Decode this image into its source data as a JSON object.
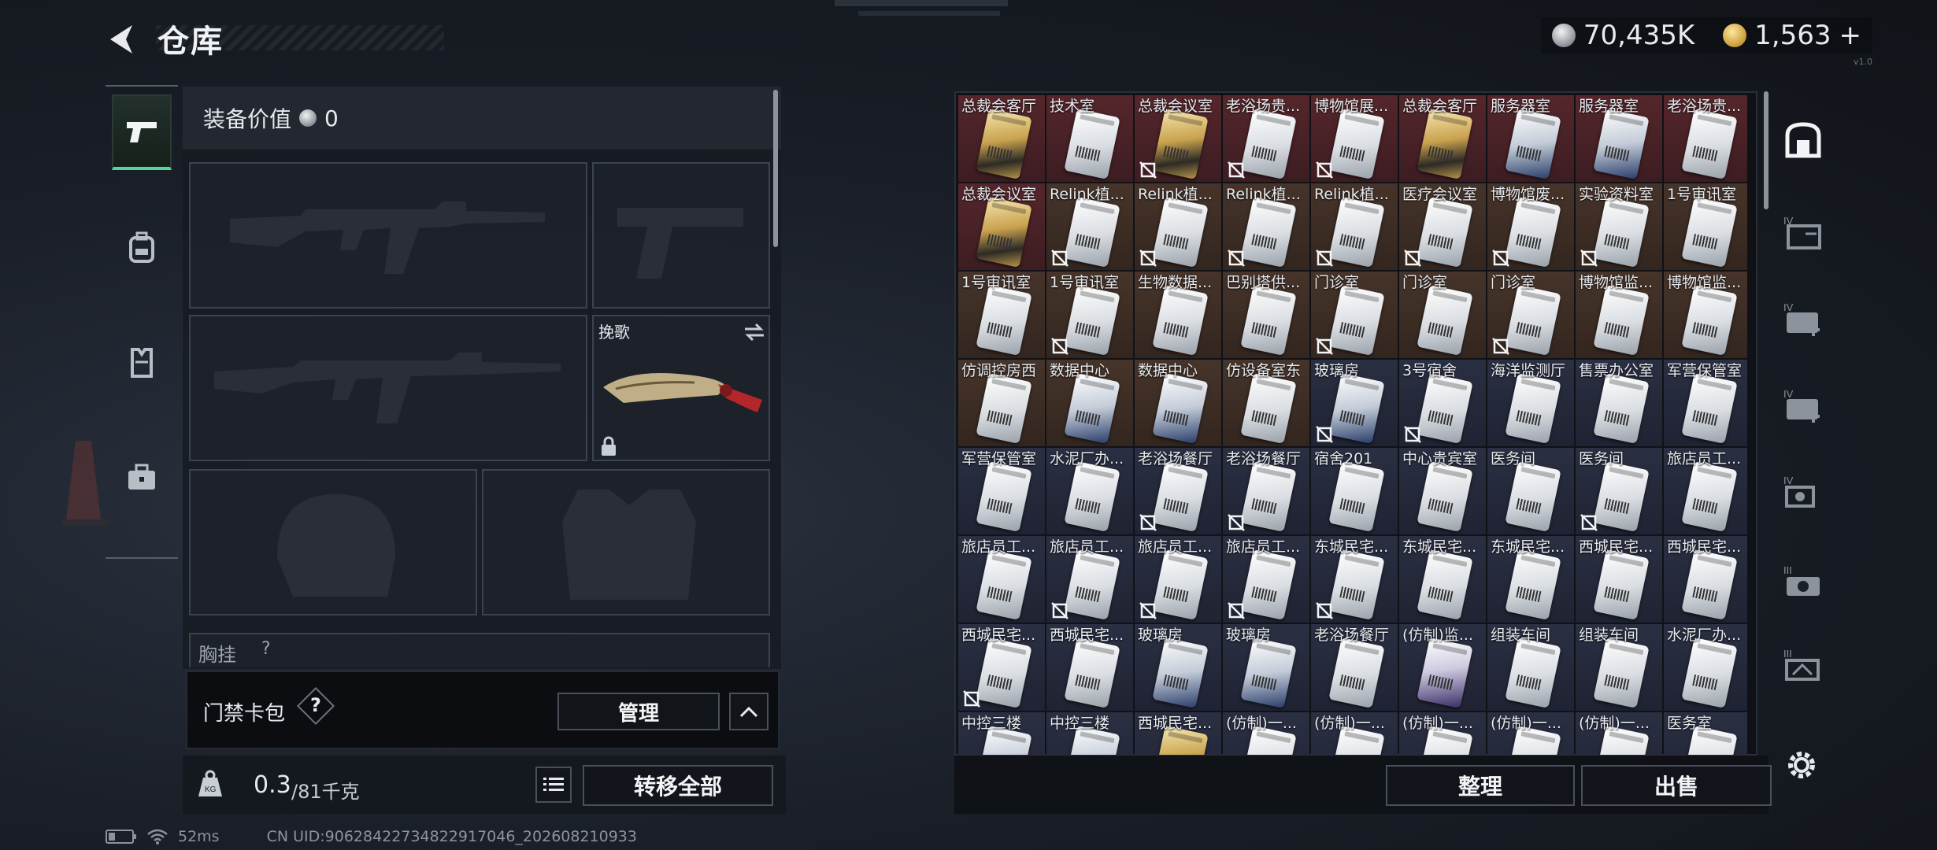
{
  "header": {
    "title": "仓库",
    "currency": [
      {
        "icon": "silver-coin-icon",
        "value": "70,435K"
      },
      {
        "icon": "gold-coin-icon",
        "value": "1,563"
      },
      {
        "icon": "plus-icon",
        "value": "+"
      }
    ],
    "version": "v1.0"
  },
  "left_tabs": [
    "pistol-icon",
    "backpack-icon",
    "vest-icon",
    "briefcase-icon"
  ],
  "equipment": {
    "value_label": "装备价值",
    "value": "0",
    "melee_name": "挽歌",
    "next_section": "胸挂",
    "next_section_help": "?"
  },
  "card_bag": {
    "label": "门禁卡包",
    "help": "?",
    "manage_label": "管理"
  },
  "weight": {
    "current": "0.3",
    "max": "/81千克"
  },
  "buttons": {
    "transfer_all": "转移全部",
    "organize": "整理",
    "sell": "出售"
  },
  "grid": {
    "cells": [
      {
        "name": "总裁会客厅",
        "bg": "r",
        "c": "gold",
        "nt": false
      },
      {
        "name": "技术室",
        "bg": "r",
        "c": "white",
        "nt": false
      },
      {
        "name": "总裁会议室",
        "bg": "r",
        "c": "gold",
        "nt": true
      },
      {
        "name": "老浴场贵...",
        "bg": "r",
        "c": "white",
        "nt": true
      },
      {
        "name": "博物馆展...",
        "bg": "r",
        "c": "white",
        "nt": true
      },
      {
        "name": "总裁会客厅",
        "bg": "r",
        "c": "gold",
        "nt": false
      },
      {
        "name": "服务器室",
        "bg": "r",
        "c": "blue",
        "nt": false
      },
      {
        "name": "服务器室",
        "bg": "r",
        "c": "blue",
        "nt": false
      },
      {
        "name": "老浴场贵...",
        "bg": "r",
        "c": "white",
        "nt": false
      },
      {
        "name": "总裁会议室",
        "bg": "r",
        "c": "gold",
        "nt": false
      },
      {
        "name": "Relink植...",
        "bg": "o",
        "c": "white",
        "nt": true
      },
      {
        "name": "Relink植...",
        "bg": "o",
        "c": "white",
        "nt": true
      },
      {
        "name": "Relink植...",
        "bg": "o",
        "c": "white",
        "nt": true
      },
      {
        "name": "Relink植...",
        "bg": "o",
        "c": "white",
        "nt": true
      },
      {
        "name": "医疗会议室",
        "bg": "o",
        "c": "white",
        "nt": true
      },
      {
        "name": "博物馆废...",
        "bg": "o",
        "c": "white",
        "nt": true
      },
      {
        "name": "实验资料室",
        "bg": "o",
        "c": "white",
        "nt": true
      },
      {
        "name": "1号审讯室",
        "bg": "o",
        "c": "white",
        "nt": false
      },
      {
        "name": "1号审讯室",
        "bg": "o",
        "c": "white",
        "nt": false
      },
      {
        "name": "1号审讯室",
        "bg": "o",
        "c": "white",
        "nt": true
      },
      {
        "name": "生物数据...",
        "bg": "o",
        "c": "white",
        "nt": false
      },
      {
        "name": "巴别塔供...",
        "bg": "o",
        "c": "white",
        "nt": false
      },
      {
        "name": "门诊室",
        "bg": "o",
        "c": "white",
        "nt": true
      },
      {
        "name": "门诊室",
        "bg": "o",
        "c": "white",
        "nt": false
      },
      {
        "name": "门诊室",
        "bg": "o",
        "c": "white",
        "nt": true
      },
      {
        "name": "博物馆监...",
        "bg": "o",
        "c": "white",
        "nt": false
      },
      {
        "name": "博物馆监...",
        "bg": "o",
        "c": "white",
        "nt": false
      },
      {
        "name": "仿调控房西",
        "bg": "o",
        "c": "white",
        "nt": false
      },
      {
        "name": "数据中心",
        "bg": "o",
        "c": "blue",
        "nt": false
      },
      {
        "name": "数据中心",
        "bg": "o",
        "c": "blue",
        "nt": false
      },
      {
        "name": "仿设备室东",
        "bg": "o",
        "c": "white",
        "nt": false
      },
      {
        "name": "玻璃房",
        "bg": "b",
        "c": "blue",
        "nt": true
      },
      {
        "name": "3号宿舍",
        "bg": "b",
        "c": "white",
        "nt": true
      },
      {
        "name": "海洋监测厅",
        "bg": "b",
        "c": "white",
        "nt": false
      },
      {
        "name": "售票办公室",
        "bg": "b",
        "c": "white",
        "nt": false
      },
      {
        "name": "军营保管室",
        "bg": "b",
        "c": "white",
        "nt": false
      },
      {
        "name": "军营保管室",
        "bg": "b",
        "c": "white",
        "nt": false
      },
      {
        "name": "水泥厂办...",
        "bg": "b",
        "c": "white",
        "nt": false
      },
      {
        "name": "老浴场餐厅",
        "bg": "b",
        "c": "white",
        "nt": true
      },
      {
        "name": "老浴场餐厅",
        "bg": "b",
        "c": "white",
        "nt": true
      },
      {
        "name": "宿舍201",
        "bg": "b",
        "c": "white",
        "nt": false
      },
      {
        "name": "中心贵宾室",
        "bg": "b",
        "c": "white",
        "nt": false
      },
      {
        "name": "医务间",
        "bg": "b",
        "c": "white",
        "nt": false
      },
      {
        "name": "医务间",
        "bg": "b",
        "c": "white",
        "nt": true
      },
      {
        "name": "旅店员工...",
        "bg": "b",
        "c": "white",
        "nt": false
      },
      {
        "name": "旅店员工...",
        "bg": "b",
        "c": "white",
        "nt": false
      },
      {
        "name": "旅店员工...",
        "bg": "b",
        "c": "white",
        "nt": true
      },
      {
        "name": "旅店员工...",
        "bg": "b",
        "c": "white",
        "nt": true
      },
      {
        "name": "旅店员工...",
        "bg": "b",
        "c": "white",
        "nt": true
      },
      {
        "name": "东城民宅...",
        "bg": "b",
        "c": "white",
        "nt": true
      },
      {
        "name": "东城民宅...",
        "bg": "b",
        "c": "white",
        "nt": false
      },
      {
        "name": "东城民宅...",
        "bg": "b",
        "c": "white",
        "nt": false
      },
      {
        "name": "西城民宅...",
        "bg": "b",
        "c": "white",
        "nt": false
      },
      {
        "name": "西城民宅...",
        "bg": "b",
        "c": "white",
        "nt": false
      },
      {
        "name": "西城民宅...",
        "bg": "b",
        "c": "white",
        "nt": true
      },
      {
        "name": "西城民宅...",
        "bg": "b",
        "c": "white",
        "nt": false
      },
      {
        "name": "玻璃房",
        "bg": "b",
        "c": "blue",
        "nt": false
      },
      {
        "name": "玻璃房",
        "bg": "b",
        "c": "blue",
        "nt": false
      },
      {
        "name": "老浴场餐厅",
        "bg": "b",
        "c": "white",
        "nt": false
      },
      {
        "name": "(仿制)监...",
        "bg": "b",
        "c": "purple",
        "nt": false
      },
      {
        "name": "组装车间",
        "bg": "b",
        "c": "white",
        "nt": false
      },
      {
        "name": "组装车间",
        "bg": "b",
        "c": "white",
        "nt": false
      },
      {
        "name": "水泥厂办...",
        "bg": "b",
        "c": "white",
        "nt": false
      },
      {
        "name": "中控三楼",
        "bg": "b",
        "c": "blue",
        "nt": false,
        "up": false
      },
      {
        "name": "中控三楼",
        "bg": "b",
        "c": "blue",
        "nt": false,
        "up": false
      },
      {
        "name": "西城民宅...",
        "bg": "b",
        "c": "gold",
        "nt": false,
        "up": false
      },
      {
        "name": "(仿制)一...",
        "bg": "b",
        "c": "white",
        "nt": false,
        "up": true
      },
      {
        "name": "(仿制)一...",
        "bg": "b",
        "c": "white",
        "nt": false,
        "up": true
      },
      {
        "name": "(仿制)一...",
        "bg": "b",
        "c": "white",
        "nt": false,
        "up": true
      },
      {
        "name": "(仿制)一...",
        "bg": "b",
        "c": "white",
        "nt": false,
        "up": true
      },
      {
        "name": "(仿制)一...",
        "bg": "b",
        "c": "white",
        "nt": false,
        "up": true
      },
      {
        "name": "医务室",
        "bg": "b",
        "c": "white",
        "nt": false,
        "up": true
      }
    ]
  },
  "right_tabs": [
    {
      "icon": "safe-box-icon",
      "level": ""
    },
    {
      "icon": "folder-case-icon",
      "level": "IV"
    },
    {
      "icon": "medkit-icon",
      "level": "IV"
    },
    {
      "icon": "medkit-plus-icon",
      "level": "IV"
    },
    {
      "icon": "device-icon",
      "level": "IV"
    },
    {
      "icon": "camera-icon",
      "level": "III"
    },
    {
      "icon": "tool-case-icon",
      "level": "III"
    }
  ],
  "status": {
    "ping": "52ms",
    "uid": "CN UID:90628422734822917046_202608210933"
  },
  "colors": {
    "row_red": "#4a2226",
    "row_orange": "#3e2d22",
    "row_blue": "#252a3a",
    "accent_green": "#4fd6a0"
  }
}
